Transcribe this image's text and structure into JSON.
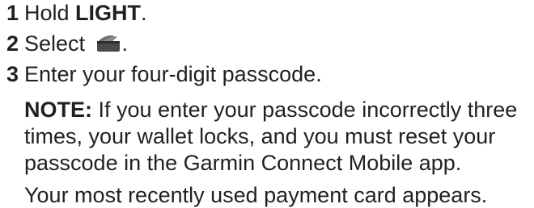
{
  "steps": [
    {
      "number": "1",
      "text_before": "Hold ",
      "bold": "LIGHT",
      "text_after": "."
    },
    {
      "number": "2",
      "text_before": "Select ",
      "icon": "wallet-icon",
      "text_after": "."
    },
    {
      "number": "3",
      "text": "Enter your four-digit passcode."
    }
  ],
  "note": {
    "label": "NOTE:",
    "lines": [
      " If you enter your passcode incorrectly three",
      "times, your wallet locks, and you must reset your",
      "passcode in the Garmin Connect Mobile app."
    ]
  },
  "result": "Your most recently used payment card appears."
}
